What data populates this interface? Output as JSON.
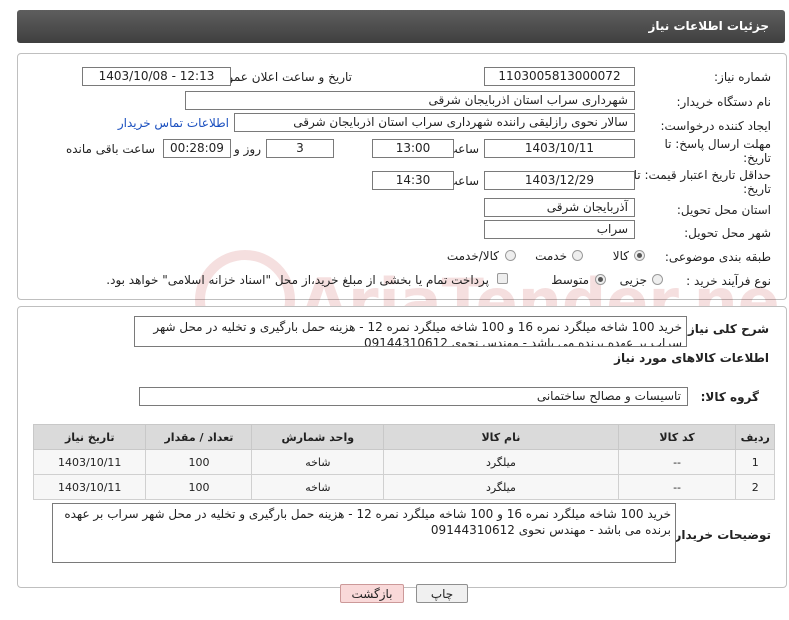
{
  "header": {
    "title": "جزئیات اطلاعات نیاز"
  },
  "form": {
    "need_number_label": "شماره نیاز:",
    "need_number": "1103005813000072",
    "announce_label": "تاریخ و ساعت اعلان عمومی:",
    "announce_value": "1403/10/08 - 12:13",
    "buyer_org_label": "نام دستگاه خریدار:",
    "buyer_org": "شهرداری سراب استان اذربایجان شرقی",
    "creator_label": "ایجاد کننده درخواست:",
    "creator": "سالار نحوی رازلیقی راننده شهرداری سراب استان اذربایجان شرقی",
    "contact_link": "اطلاعات تماس خریدار",
    "deadline_label_1": "مهلت ارسال پاسخ: تا",
    "deadline_label_2": "تاریخ:",
    "deadline_date": "1403/10/11",
    "time_label": "ساعت",
    "deadline_time": "13:00",
    "days_value": "3",
    "days_label": "روز و",
    "remaining_time": "00:28:09",
    "remaining_label": "ساعت باقی مانده",
    "price_valid_label_1": "حداقل تاریخ اعتبار قیمت: تا",
    "price_valid_label_2": "تاریخ:",
    "price_valid_date": "1403/12/29",
    "price_valid_time": "14:30",
    "province_label": "استان محل تحویل:",
    "province": "آذربایجان شرقی",
    "city_label": "شهر محل تحویل:",
    "city": "سراب",
    "category_label": "طبقه بندی موضوعی:",
    "category_options": [
      "کالا",
      "خدمت",
      "کالا/خدمت"
    ],
    "process_label": "نوع فرآیند خرید :",
    "process_options": [
      "جزیی",
      "متوسط"
    ],
    "payment_note": "پرداخت تمام یا بخشی از مبلغ خرید،از محل \"اسناد خزانه اسلامی\" خواهد بود."
  },
  "summary": {
    "label": "شرح کلی نیاز:",
    "text": "خرید 100 شاخه میلگرد نمره 16 و 100 شاخه میلگرد نمره 12 - هزینه حمل بارگیری و تخلیه  در محل شهر سراب بر عهده برنده می باشد - مهندس نحوی 09144310612"
  },
  "goods": {
    "section_title": "اطلاعات کالاهای مورد نیاز",
    "group_label": "گروه کالا:",
    "group_value": "تاسیسات و مصالح ساختمانی",
    "columns": [
      "ردیف",
      "کد کالا",
      "نام کالا",
      "واحد شمارش",
      "تعداد / مقدار",
      "تاریخ نیاز"
    ],
    "rows": [
      [
        "1",
        "--",
        "میلگرد",
        "شاخه",
        "100",
        "1403/10/11"
      ],
      [
        "2",
        "--",
        "میلگرد",
        "شاخه",
        "100",
        "1403/10/11"
      ]
    ]
  },
  "buyer_notes": {
    "label": "توضیحات خریدار:",
    "text": "خرید 100 شاخه میلگرد نمره 16 و 100 شاخه میلگرد نمره 12 - هزینه حمل بارگیری و تخلیه  در محل شهر سراب بر عهده برنده می باشد - مهندس نحوی 09144310612"
  },
  "buttons": {
    "print": "چاپ",
    "back": "بازگشت"
  },
  "watermark": {
    "text": "AriaTender.neT"
  },
  "colors": {
    "header_bg": "#4a4a4a",
    "link": "#1a4fbf",
    "table_header": "#dadada",
    "back_button_bg": "#f9d9d9"
  }
}
